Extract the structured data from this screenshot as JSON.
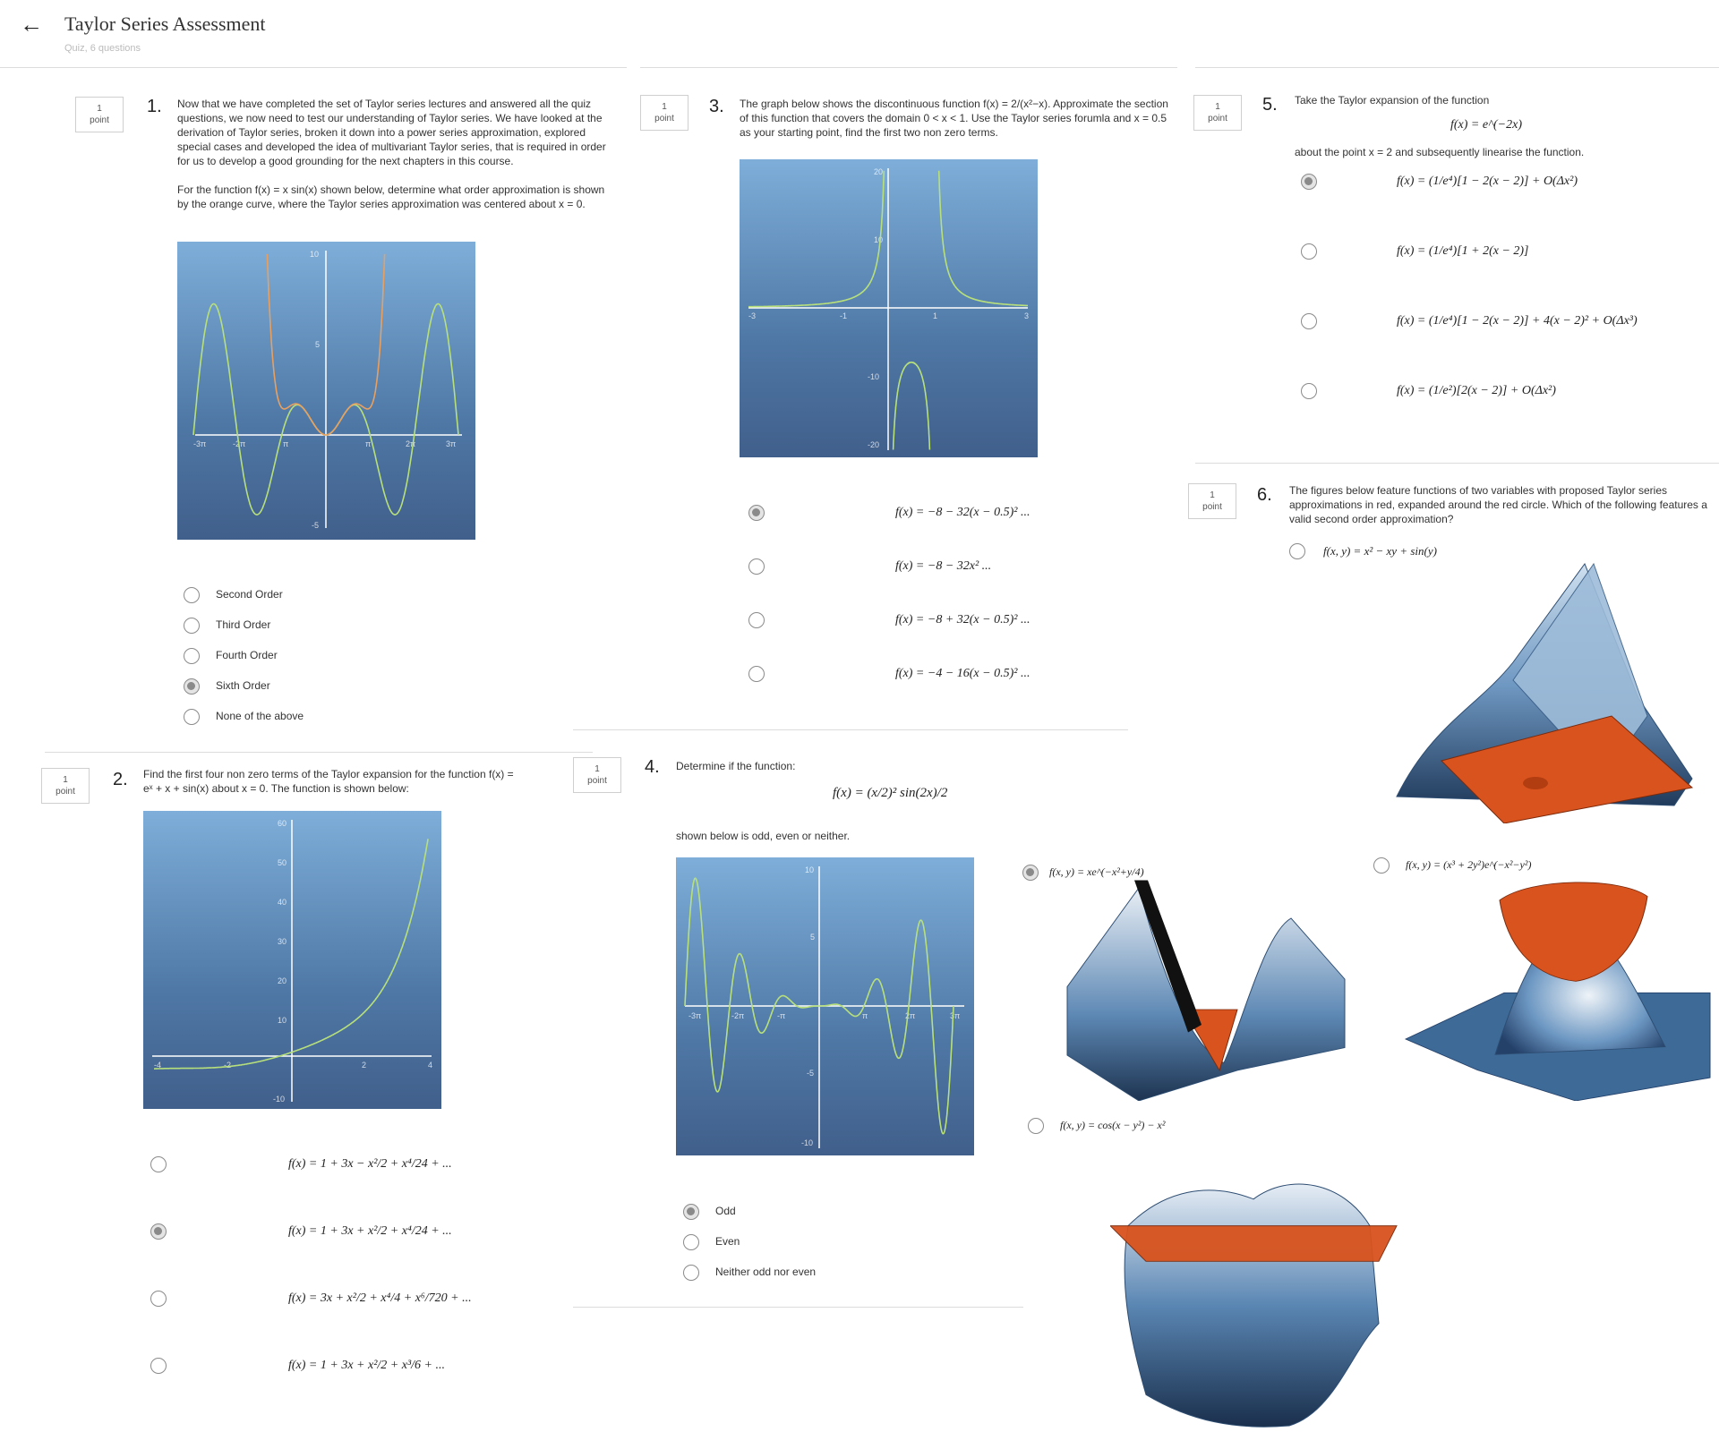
{
  "header": {
    "title": "Taylor Series Assessment",
    "subtitle": "Quiz, 6 questions"
  },
  "q1": {
    "number": "1.",
    "point": [
      "1",
      "point"
    ],
    "text_a": "Now that we have completed the set of Taylor series lectures and answered all the quiz questions, we now need to test our understanding of Taylor series. We have looked at the derivation of Taylor series, broken it down into a power series approximation, explored special cases and developed the idea of multivariant Taylor series, that is required in order for us to develop a good grounding for the next chapters in this course.",
    "text_b": "For the function f(x) = x sin(x) shown below, determine what order approximation is shown by the orange curve, where the Taylor series approximation was centered about x = 0.",
    "plot_ticks_x": [
      "-3π",
      "-2π",
      "π",
      "π",
      "2π",
      "3π"
    ],
    "plot_ticks_y": [
      "10",
      "5",
      "-5"
    ],
    "options": [
      "Second Order",
      "Third Order",
      "Fourth Order",
      "Sixth Order",
      "None of the above"
    ],
    "selected": 3
  },
  "q2": {
    "number": "2.",
    "point": [
      "1",
      "point"
    ],
    "text": "Find the first four non zero terms of the Taylor expansion for the function f(x) = eˣ + x + sin(x) about x = 0. The function is shown below:",
    "plot_ticks_x": [
      "-4",
      "-2",
      "2",
      "4"
    ],
    "plot_ticks_y": [
      "60",
      "50",
      "40",
      "30",
      "20",
      "10",
      "-10"
    ],
    "options": [
      "f(x) = 1 + 3x − x²/2 + x⁴/24 + ...",
      "f(x) = 1 + 3x + x²/2 + x⁴/24 + ...",
      "f(x) = 3x + x²/2 + x⁴/4 + x⁶/720 + ...",
      "f(x) = 1 + 3x + x²/2 + x³/6 + ..."
    ],
    "selected": 1
  },
  "q3": {
    "number": "3.",
    "point": [
      "1",
      "point"
    ],
    "text": "The graph below shows the discontinuous function f(x) = 2/(x²−x). Approximate the section of this function that covers the domain 0 < x < 1. Use the Taylor series forumla and x = 0.5 as your starting point, find the first two non zero terms.",
    "plot_ticks_x": [
      "-3",
      "-1",
      "1",
      "3"
    ],
    "plot_ticks_y": [
      "20",
      "10",
      "-10",
      "-20"
    ],
    "options": [
      "f(x) = −8 − 32(x − 0.5)² ...",
      "f(x) = −8 − 32x² ...",
      "f(x) = −8 + 32(x − 0.5)² ...",
      "f(x) = −4 − 16(x − 0.5)² ..."
    ],
    "selected": 0
  },
  "q4": {
    "number": "4.",
    "point": [
      "1",
      "point"
    ],
    "text_a": "Determine if the function:",
    "formula": "f(x) = (x/2)² sin(2x)/2",
    "text_b": "shown below is odd, even or neither.",
    "plot_ticks_x": [
      "-3π",
      "-2π",
      "-π",
      "π",
      "2π",
      "3π"
    ],
    "plot_ticks_y": [
      "10",
      "5",
      "-5",
      "-10"
    ],
    "options": [
      "Odd",
      "Even",
      "Neither odd nor even"
    ],
    "selected": 0
  },
  "q5": {
    "number": "5.",
    "point": [
      "1",
      "point"
    ],
    "text_a": "Take the Taylor expansion of the function",
    "formula": "f(x) = e^(−2x)",
    "text_b": "about the point x = 2 and subsequently linearise the function.",
    "options": [
      "f(x) = (1/e⁴)[1 − 2(x − 2)] + O(Δx²)",
      "f(x) = (1/e⁴)[1 + 2(x − 2)]",
      "f(x) = (1/e⁴)[1 − 2(x − 2)] + 4(x − 2)² + O(Δx³)",
      "f(x) = (1/e²)[2(x − 2)] + O(Δx²)"
    ],
    "selected": 0
  },
  "q6": {
    "number": "6.",
    "point": [
      "1",
      "point"
    ],
    "text": "The figures below feature functions of two variables with proposed Taylor series approximations in red, expanded around the red circle. Which of the following features a valid second order approximation?",
    "options": [
      "f(x, y) = x² − xy + sin(y)",
      "f(x, y) = xe^(−x²+y/4)",
      "f(x, y) = (x³ + 2y²)e^(−x²−y²)",
      "f(x, y) = cos(x − y²) − x²"
    ],
    "selected": 1
  },
  "colors": {
    "curve_green": "#b8e07a",
    "curve_orange": "#e8a060",
    "plot_top": "#7eaed9",
    "plot_bottom": "#415f8b",
    "surface_blue": "#4d7aa8",
    "surface_red": "#d9531e"
  }
}
